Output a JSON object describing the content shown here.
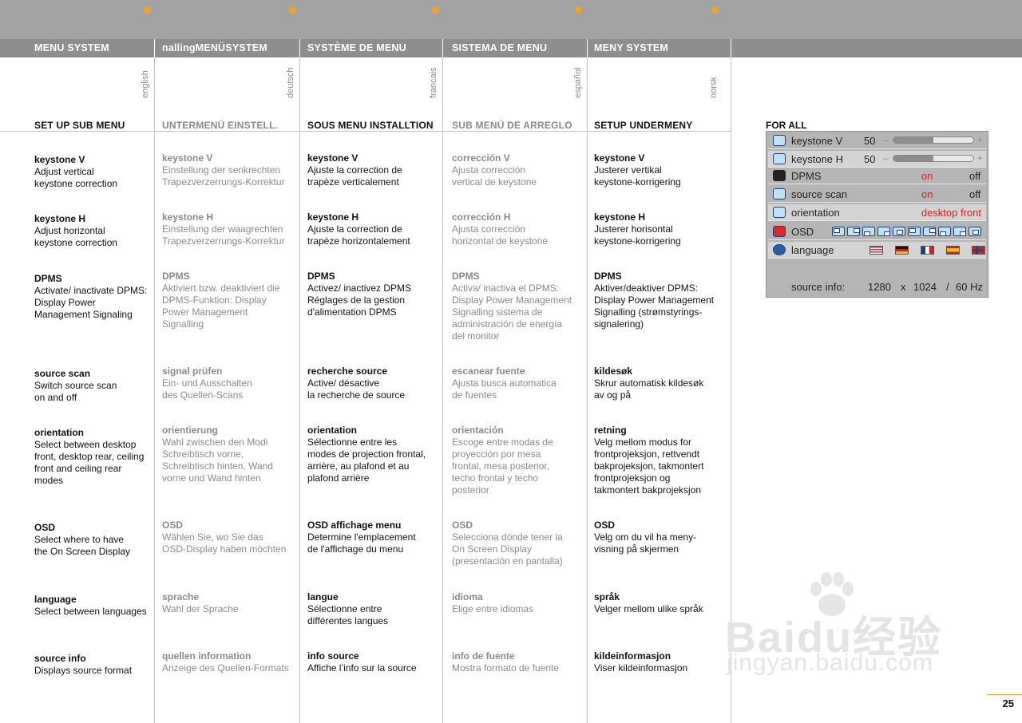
{
  "columns": [
    {
      "header": "MENU SYSTEM",
      "lang": "english",
      "subhead": "SET UP SUB MENU",
      "entries": [
        {
          "title": "keystone V",
          "desc": "Adjust vertical\nkeystone correction"
        },
        {
          "title": "keystone H",
          "desc": "Adjust horizontal\nkeystone correction"
        },
        {
          "title": "DPMS",
          "desc": "Activate/ inactivate DPMS:\nDisplay Power\nManagement Signaling"
        },
        {
          "title": "source scan",
          "desc": "Switch source scan\non and off"
        },
        {
          "title": "orientation",
          "desc": "Select between desktop\nfront, desktop rear, ceiling\nfront and ceiling rear\nmodes"
        },
        {
          "title": "OSD",
          "desc": "Select where to have\nthe On Screen Display"
        },
        {
          "title": "language",
          "desc": "Select between languages"
        },
        {
          "title": "source info",
          "desc": "Displays source format"
        }
      ]
    },
    {
      "header": "nallingMENÜSYSTEM",
      "lang": "deutsch",
      "subhead": "UNTERMENÜ EINSTELL.",
      "entries": [
        {
          "title": "keystone V",
          "desc": "Einstellung der senkrechten\nTrapezverzerrungs-Korrektur"
        },
        {
          "title": "keystone H",
          "desc": "Einstellung der waagrechten\nTrapezverzerrungs-Korrektur"
        },
        {
          "title": "DPMS",
          "desc": "Aktiviert bzw. deaktiviert die\nDPMS-Funktion: Display\nPower Management\nSignalling"
        },
        {
          "title": "signal prüfen",
          "desc": "Ein- und Ausschalten\ndes Quellen-Scans"
        },
        {
          "title": "orientierung",
          "desc": "Wahl zwischen den Modi\nSchreibtisch vorne,\nSchreibtisch hinten, Wand\nvorne und Wand hinten"
        },
        {
          "title": "OSD",
          "desc": "Wählen Sie, wo Sie das\nOSD-Display haben möchten"
        },
        {
          "title": "sprache",
          "desc": "Wahl der Sprache"
        },
        {
          "title": "quellen information",
          "desc": "Anzeige des Quellen-Formats"
        }
      ]
    },
    {
      "header": "SYSTÈME DE MENU",
      "lang": "francais",
      "subhead": "SOUS MENU INSTALLTION",
      "entries": [
        {
          "title": "keystone V",
          "desc": "Ajuste la correction de\ntrapèze verticalement"
        },
        {
          "title": "keystone H",
          "desc": "Ajuste la correction de\ntrapèze horizontalement"
        },
        {
          "title": "DPMS",
          "desc": "Activez/ inactivez DPMS\nRéglages de la gestion\nd'alimentation DPMS"
        },
        {
          "title": "recherche source",
          "desc": "Active/ désactive\nla recherche de source"
        },
        {
          "title": "orientation",
          "desc": "Sélectionne entre les\nmodes de projection frontal,\narrière, au plafond et au\nplafond arrière"
        },
        {
          "title": "OSD affichage menu",
          "desc": "Determine l'emplacement\nde l'affichage du menu"
        },
        {
          "title": "langue",
          "desc": "Sélectionne entre\ndifférentes langues"
        },
        {
          "title": "info source",
          "desc": "Affiche l’info sur la source"
        }
      ]
    },
    {
      "header": "SISTEMA DE MENU",
      "lang": "español",
      "subhead": "SUB MENÚ DE ARREGLO",
      "entries": [
        {
          "title": "corrección V",
          "desc": "Ajusta corrección\nvertical de keystone"
        },
        {
          "title": "corrección  H",
          "desc": "Ajusta corrección\nhorizontal de keystone"
        },
        {
          "title": "DPMS",
          "desc": "Activa/ inactiva el DPMS:\nDisplay Power Management\nSignalling sistema de\nadministración de energía\ndel monitor"
        },
        {
          "title": "escanear fuente",
          "desc": "Ajusta busca automatica\nde fuentes"
        },
        {
          "title": "orientación",
          "desc": "Escoge entre modas de\nproyección por mesa\nfrontal, mesa posterior,\ntecho frontal y techo\nposterior"
        },
        {
          "title": "OSD",
          "desc": "Selecciona dónde tener la\nOn Screen Display\n(presentación en pantalla)"
        },
        {
          "title": "idioma",
          "desc": "Elige entre idiomas"
        },
        {
          "title": "info de fuente",
          "desc": "Mostra formato de fuente"
        }
      ]
    },
    {
      "header": "MENY SYSTEM",
      "lang": "norsk",
      "subhead": "SETUP UNDERMENY",
      "entries": [
        {
          "title": "keystone V",
          "desc": "Justerer vertikal\nkeystone-korrigering"
        },
        {
          "title": "keystone H",
          "desc": "Justerer horisontal\nkeystone-korrigering"
        },
        {
          "title": "DPMS",
          "desc": "Aktiver/deaktiver DPMS:\nDisplay Power Management\nSignalling (strømstyrings-\nsignalering)"
        },
        {
          "title": "kildesøk",
          "desc": "Skrur automatisk kildesøk\nav og på"
        },
        {
          "title": "retning",
          "desc": "Velg mellom modus for\nfrontprojeksjon, rettvendt\nbakprojeksjon, takmontert\nfrontprojeksjon og\ntakmontert bakprojeksjon"
        },
        {
          "title": "OSD",
          "desc": "Velg om du vil ha meny-\nvisning på skjermen"
        },
        {
          "title": "språk",
          "desc": "Velger mellom ulike språk"
        },
        {
          "title": "kildeinformasjon",
          "desc": "Viser kildeinformasjon"
        }
      ]
    }
  ],
  "panel": {
    "heading": "FOR ALL",
    "keystone_v": {
      "label": "keystone V",
      "value": "50",
      "level_fraction": 0.5,
      "minus": "–",
      "plus": "+"
    },
    "keystone_h": {
      "label": "keystone H",
      "value": "50",
      "level_fraction": 0.5,
      "minus": "–",
      "plus": "+"
    },
    "dpms": {
      "label": "DPMS",
      "on": "on",
      "off": "off"
    },
    "source_scan": {
      "label": "source scan",
      "on": "on",
      "off": "off"
    },
    "orientation": {
      "label": "orientation",
      "value": "desktop front"
    },
    "osd": {
      "label": "OSD",
      "position_count": 10
    },
    "language": {
      "label": "language",
      "flags": [
        "us",
        "de",
        "fr",
        "es",
        "no"
      ]
    },
    "source_info": {
      "label": "source info:",
      "width": "1280",
      "x": "x",
      "height": "1024",
      "sep": "/",
      "rate": "60 Hz"
    }
  },
  "colors": {
    "accent_dot": "#f2a324",
    "selected_red": "#d62222",
    "header_bg": "#8e8e8e",
    "grey_text": "#8a8a8a"
  },
  "watermark": {
    "brand": "Baidu经验",
    "url": "jingyan.baidu.com"
  },
  "page_number": "25"
}
